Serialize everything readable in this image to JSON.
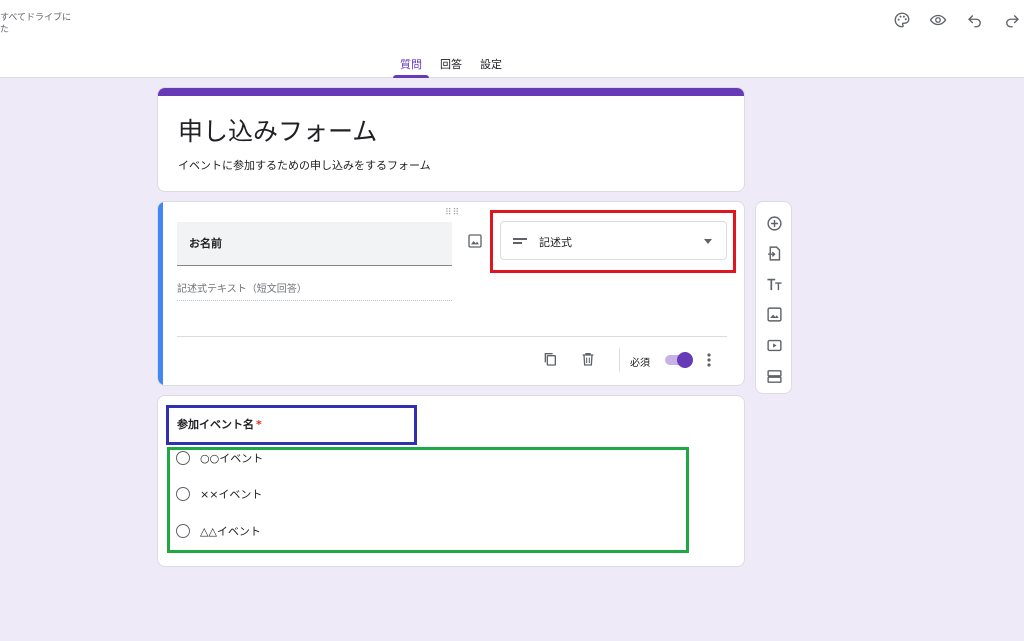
{
  "header": {
    "save_status": "すべてドライブに\nた",
    "tabs": [
      {
        "label": "質問",
        "active": true
      },
      {
        "label": "回答",
        "active": false
      },
      {
        "label": "設定",
        "active": false
      }
    ],
    "icons": [
      "palette-icon",
      "eye-icon",
      "undo-icon",
      "redo-icon"
    ]
  },
  "form": {
    "title": "申し込みフォーム",
    "description": "イベントに参加するための申し込みをするフォーム"
  },
  "question1": {
    "title": "お名前",
    "type": "記述式",
    "answer_hint": "記述式テキスト（短文回答）",
    "required_label": "必須",
    "required_on": true
  },
  "question2": {
    "title": "参加イベント名",
    "required_mark": "*",
    "options": [
      "○○イベント",
      "××イベント",
      "△△イベント"
    ]
  },
  "side_toolbar": {
    "tools": [
      "add-question-icon",
      "import-questions-icon",
      "add-title-icon",
      "add-image-icon",
      "add-video-icon",
      "add-section-icon"
    ]
  },
  "colors": {
    "accent": "#673ab7",
    "background": "#efeaf8",
    "active_card_bar": "#4285f4",
    "highlight_red": "#e0161e",
    "highlight_blue": "#3030b0",
    "highlight_green": "#1fa843"
  }
}
